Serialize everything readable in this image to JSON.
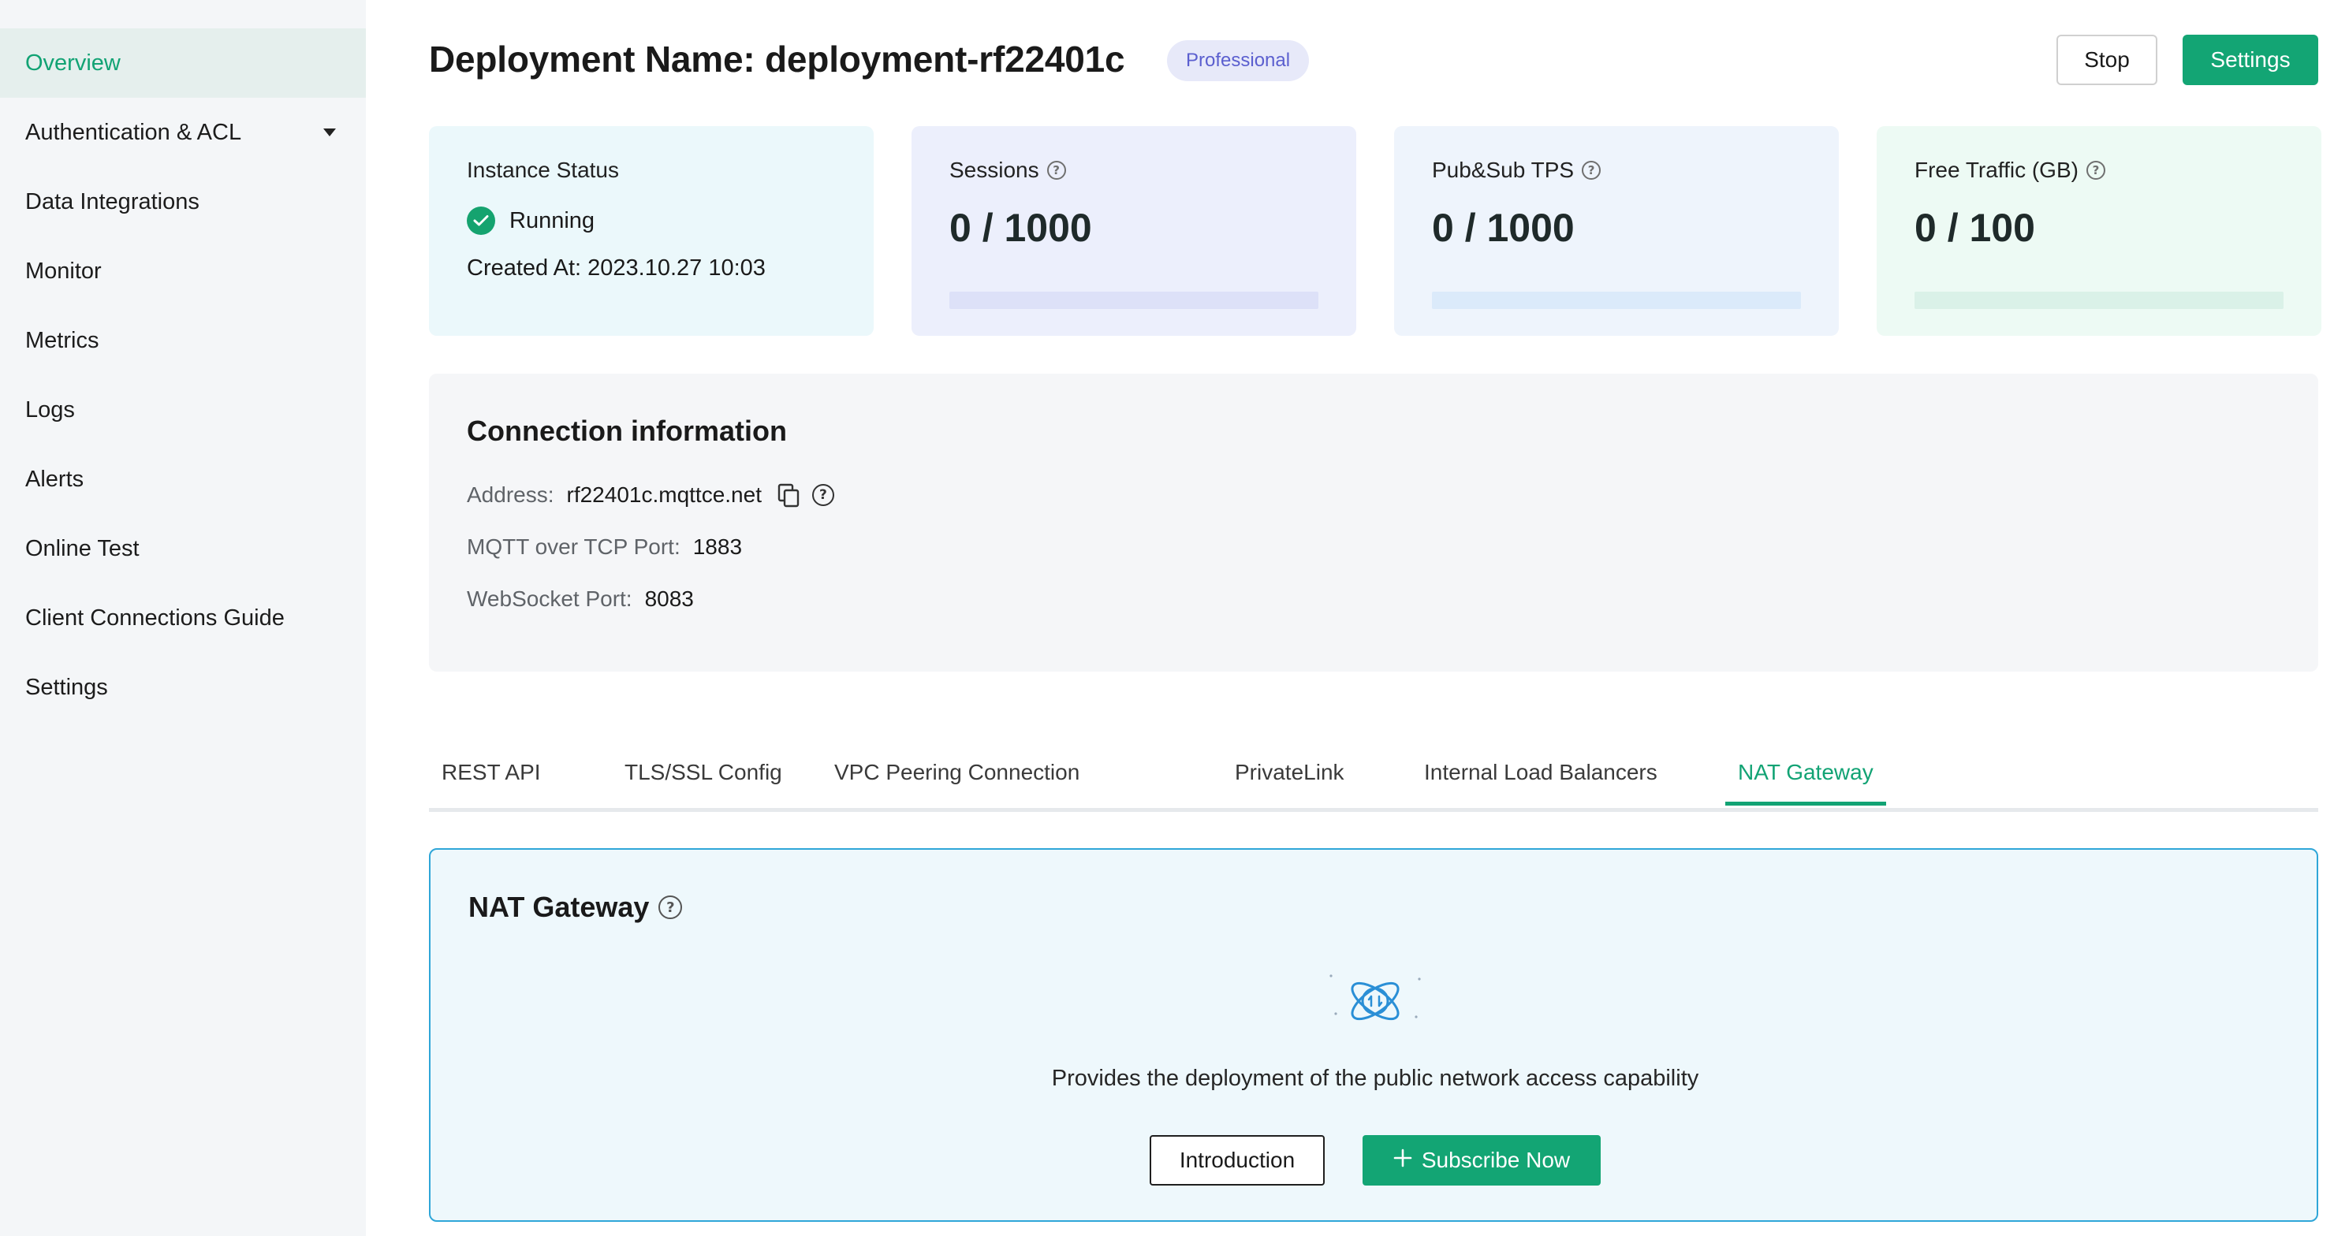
{
  "sidebar": {
    "items": [
      {
        "label": "Overview",
        "active": true
      },
      {
        "label": "Authentication & ACL",
        "has_caret": true
      },
      {
        "label": "Data Integrations"
      },
      {
        "label": "Monitor"
      },
      {
        "label": "Metrics"
      },
      {
        "label": "Logs"
      },
      {
        "label": "Alerts"
      },
      {
        "label": "Online Test"
      },
      {
        "label": "Client Connections Guide"
      },
      {
        "label": "Settings"
      }
    ]
  },
  "header": {
    "title": "Deployment Name: deployment-rf22401c",
    "badge": "Professional",
    "stop_label": "Stop",
    "settings_label": "Settings"
  },
  "status_card": {
    "label": "Instance Status",
    "status": "Running",
    "created": "Created At: 2023.10.27 10:03"
  },
  "stats": [
    {
      "label": "Sessions",
      "value": "0 / 1000",
      "used": 0,
      "total": 1000,
      "color": "#e6e9fa",
      "bar_color": "#dde1f8"
    },
    {
      "label": "Pub&Sub TPS",
      "value": "0 / 1000",
      "used": 0,
      "total": 1000,
      "color": "#eaf2fc",
      "bar_color": "#dbeafa"
    },
    {
      "label": "Free Traffic (GB)",
      "value": "0 / 100",
      "used": 0,
      "total": 100,
      "color": "#ebf9f3",
      "bar_color": "#daf1e8"
    }
  ],
  "connection": {
    "title": "Connection information",
    "address_key": "Address:",
    "address_value": "rf22401c.mqttce.net",
    "tcp_key": "MQTT over TCP Port:",
    "tcp_value": "1883",
    "ws_key": "WebSocket Port:",
    "ws_value": "8083"
  },
  "tabs": [
    {
      "label": "REST API"
    },
    {
      "label": "TLS/SSL Config"
    },
    {
      "label": "VPC Peering Connection"
    },
    {
      "label": "PrivateLink"
    },
    {
      "label": "Internal Load Balancers"
    },
    {
      "label": "NAT Gateway",
      "active": true
    }
  ],
  "nat": {
    "title": "NAT Gateway",
    "description": "Provides the deployment of the public network access capability",
    "intro_label": "Introduction",
    "subscribe_label": "Subscribe Now"
  },
  "colors": {
    "accent": "#13a574",
    "active_tab": "#12a374",
    "badge_bg": "#e7e9f9",
    "badge_text": "#5b5fcf",
    "nat_border": "#2fa6d8"
  }
}
